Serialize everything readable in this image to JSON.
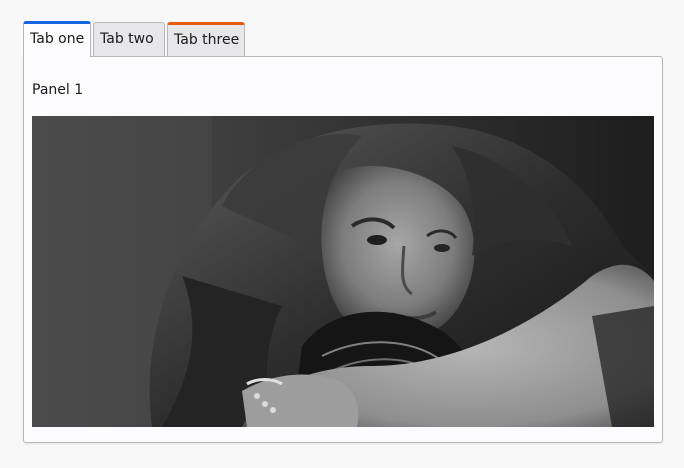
{
  "tabs": [
    {
      "label": "Tab one",
      "active": true,
      "accent": "#1565e0"
    },
    {
      "label": "Tab two",
      "active": false
    },
    {
      "label": "Tab three",
      "active": false,
      "accent": "#e8590c"
    }
  ],
  "panel": {
    "label": "Panel 1"
  }
}
